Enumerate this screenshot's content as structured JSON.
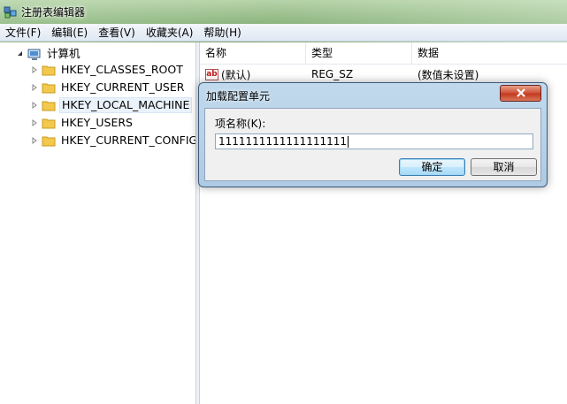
{
  "window": {
    "title": "注册表编辑器"
  },
  "menu": [
    "文件(F)",
    "编辑(E)",
    "查看(V)",
    "收藏夹(A)",
    "帮助(H)"
  ],
  "tree": {
    "root": "计算机",
    "nodes": [
      {
        "label": "HKEY_CLASSES_ROOT"
      },
      {
        "label": "HKEY_CURRENT_USER"
      },
      {
        "label": "HKEY_LOCAL_MACHINE"
      },
      {
        "label": "HKEY_USERS"
      },
      {
        "label": "HKEY_CURRENT_CONFIG"
      }
    ]
  },
  "list": {
    "columns": [
      "名称",
      "类型",
      "数据"
    ],
    "rows": [
      {
        "name": "(默认)",
        "type": "REG_SZ",
        "data": "(数值未设置)"
      }
    ]
  },
  "dialog": {
    "title": "加载配置单元",
    "field_label": "项名称(K):",
    "field_value": "1111111111111111111",
    "ok_label": "确定",
    "cancel_label": "取消"
  },
  "colors": {
    "close_button": "#c33a20",
    "selection": "#eaf2fb",
    "folder": "#f2c94c"
  }
}
